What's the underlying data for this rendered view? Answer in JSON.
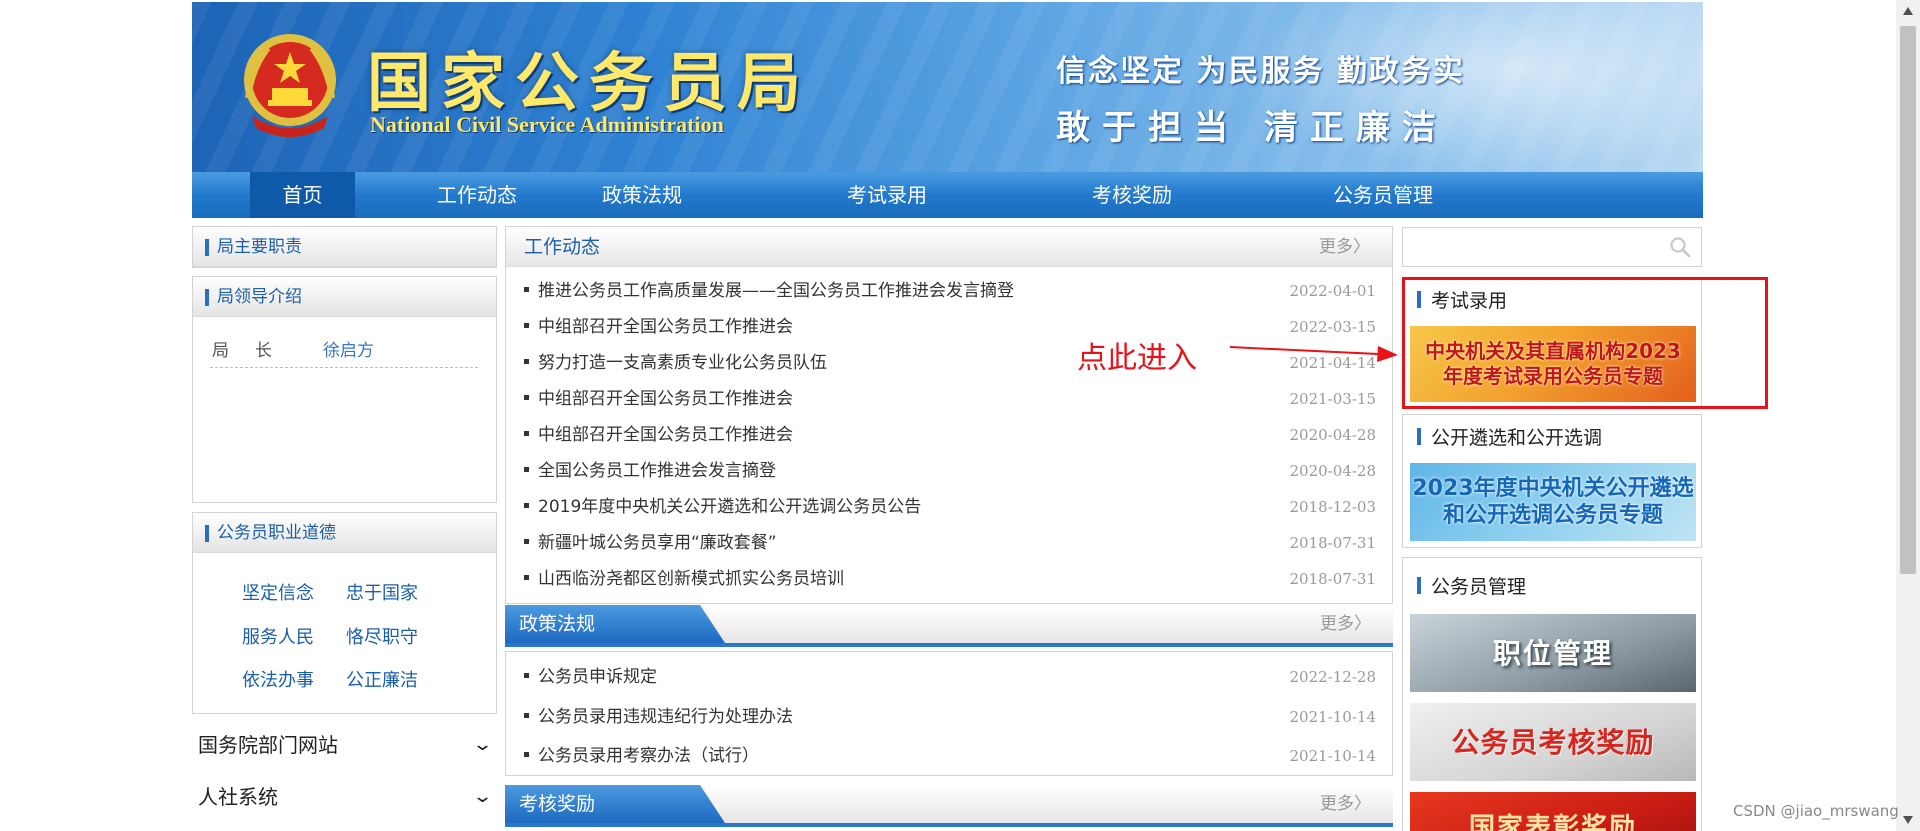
{
  "banner": {
    "title_cn": "国家公务员局",
    "title_en": "National Civil Service Administration",
    "slogan_line1": "信念坚定 为民服务 勤政务实",
    "slogan_line2": "敢于担当 清正廉洁"
  },
  "nav": {
    "items": [
      "首页",
      "工作动态",
      "政策法规",
      "考试录用",
      "考核奖励",
      "公务员管理"
    ],
    "active": "首页"
  },
  "left": {
    "duties_title": "局主要职责",
    "leaders_title": "局领导介绍",
    "leader_role": "局长",
    "leader_name": "徐启方",
    "ethics_title": "公务员职业道德",
    "ethics_items": [
      "坚定信念",
      "忠于国家",
      "服务人民",
      "恪尽职守",
      "依法办事",
      "公正廉洁"
    ],
    "dropdowns": [
      "国务院部门网站",
      "人社系统"
    ]
  },
  "center": {
    "news_title": "工作动态",
    "more_label": "更多〉",
    "news": [
      {
        "title": "推进公务员工作高质量发展——全国公务员工作推进会发言摘登",
        "date": "2022-04-01"
      },
      {
        "title": "中组部召开全国公务员工作推进会",
        "date": "2022-03-15"
      },
      {
        "title": "努力打造一支高素质专业化公务员队伍",
        "date": "2021-04-14"
      },
      {
        "title": "中组部召开全国公务员工作推进会",
        "date": "2021-03-15"
      },
      {
        "title": "中组部召开全国公务员工作推进会",
        "date": "2020-04-28"
      },
      {
        "title": "全国公务员工作推进会发言摘登",
        "date": "2020-04-28"
      },
      {
        "title": "2019年度中央机关公开遴选和公开选调公务员公告",
        "date": "2018-12-03"
      },
      {
        "title": "新疆叶城公务员享用“廉政套餐”",
        "date": "2018-07-31"
      },
      {
        "title": "山西临汾尧都区创新模式抓实公务员培训",
        "date": "2018-07-31"
      }
    ],
    "policy_title": "政策法规",
    "policy": [
      {
        "title": "公务员申诉规定",
        "date": "2022-12-28"
      },
      {
        "title": "公务员录用违规违纪行为处理办法",
        "date": "2021-10-14"
      },
      {
        "title": "公务员录用考察办法（试行）",
        "date": "2021-10-14"
      }
    ],
    "reward_title": "考核奖励"
  },
  "right": {
    "search_placeholder": "",
    "exam_title": "考试录用",
    "exam_promo_line1": "中央机关及其直属机构2023",
    "exam_promo_line2": "年度考试录用公务员专题",
    "select_title": "公开遴选和公开选调",
    "select_promo_line1": "2023年度中央机关公开遴选",
    "select_promo_line2": "和公开选调公务员专题",
    "manage_title": "公务员管理",
    "manage_promos": [
      "职位管理",
      "公务员考核奖励",
      "国家表彰奖励"
    ]
  },
  "annotation": {
    "text": "点此进入",
    "color": "#e8121b"
  },
  "watermark": "CSDN @jiao_mrswang",
  "colors": {
    "nav_blue": "#2279cc",
    "nav_active": "#0f5aa8",
    "link_blue": "#1c5fa8",
    "logo_yellow": "#ffe86a"
  }
}
